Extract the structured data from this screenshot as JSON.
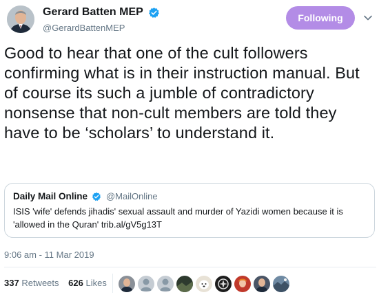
{
  "author": {
    "display_name": "Gerard Batten MEP",
    "handle": "@GerardBattenMEP",
    "verified": true,
    "avatar_icon": "person-portrait-icon"
  },
  "follow_button": {
    "label": "Following",
    "color": "#b38ce6"
  },
  "tweet": {
    "text": "Good to hear that one of the cult followers confirming what is in their instruction manual. But of course its such a jumble of contradictory nonsense that non-cult members are told they have to be ‘scholars’ to understand it.",
    "timestamp": "9:06 am - 11 Mar 2019"
  },
  "quoted_tweet": {
    "display_name": "Daily Mail Online",
    "handle": "@MailOnline",
    "verified": true,
    "text": "ISIS 'wife' defends jihadis' sexual assault and murder of Yazidi women because it is 'allowed in the Quran' trib.al/gV5g13T"
  },
  "stats": {
    "retweets_count": "337",
    "retweets_label": "Retweets",
    "likes_count": "626",
    "likes_label": "Likes"
  },
  "likers": [
    {
      "icon": "person-portrait-icon",
      "bg": "#8a9098"
    },
    {
      "icon": "default-egg-avatar-icon",
      "bg": "#c5ccd3"
    },
    {
      "icon": "default-egg-avatar-icon",
      "bg": "#c5ccd3"
    },
    {
      "icon": "dark-photo-avatar-icon",
      "bg": "#2d3a2e"
    },
    {
      "icon": "dog-avatar-icon",
      "bg": "#e8e2d6"
    },
    {
      "icon": "emblem-avatar-icon",
      "bg": "#1d1d1d"
    },
    {
      "icon": "red-portrait-avatar-icon",
      "bg": "#c0392b"
    },
    {
      "icon": "person-portrait-icon",
      "bg": "#4a5566"
    },
    {
      "icon": "landscape-avatar-icon",
      "bg": "#6f8aa3"
    }
  ],
  "colors": {
    "verified_blue": "#1da1f2",
    "secondary_text": "#657786"
  }
}
